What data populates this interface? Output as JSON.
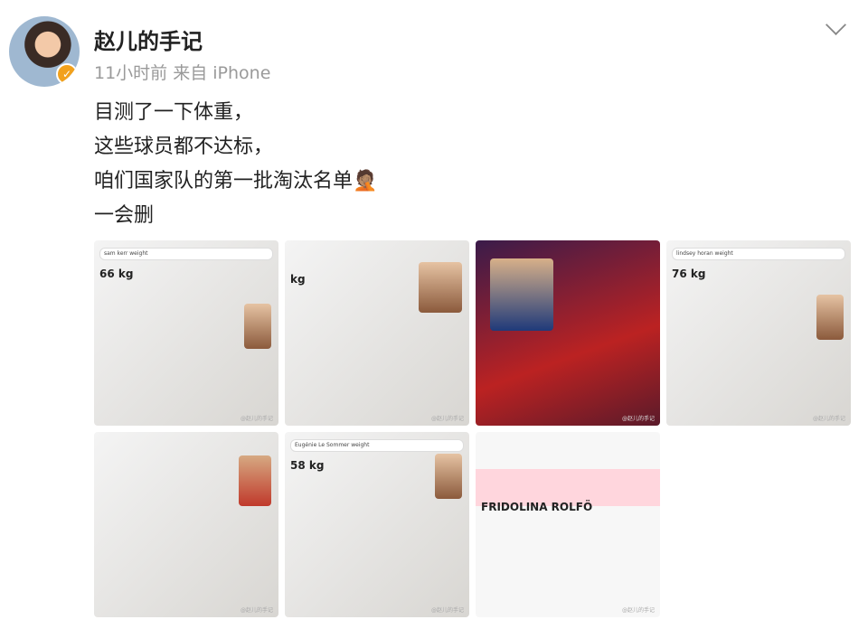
{
  "post": {
    "username": "赵儿的手记",
    "meta": "11小时前 来自 iPhone",
    "lines": [
      "目测了一下体重，",
      "这些球员都不达标，",
      "咱们国家队的第一批淘汰名单🤦🏽",
      "一会删"
    ]
  },
  "tiles": [
    {
      "search": "sam kerr weight",
      "value": "66 kg",
      "watermark": "@赵儿的手记"
    },
    {
      "search": "",
      "value": "kg",
      "watermark": "@赵儿的手记"
    },
    {
      "search": "",
      "value": "",
      "watermark": "@赵儿的手记"
    },
    {
      "search": "lindsey horan weight",
      "value": "76 kg",
      "watermark": "@赵儿的手记"
    },
    {
      "search": "",
      "value": "",
      "watermark": "@赵儿的手记"
    },
    {
      "search": "Eugénie Le Sommer weight",
      "value": "58 kg",
      "watermark": "@赵儿的手记"
    },
    {
      "search": "",
      "value": "FRIDOLINA ROLFÖ",
      "watermark": "@赵儿的手记"
    }
  ]
}
